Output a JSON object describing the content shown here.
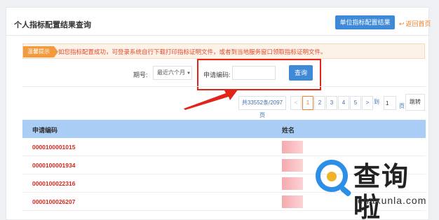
{
  "header": {
    "title": "个人指标配置结果查询",
    "unit_button": "单位指标配置结果",
    "back_label": "返回首页",
    "back_icon": "undo-icon"
  },
  "notice": {
    "tag": "温馨提示",
    "text": "如您指标配置成功，可登录系统自行下载打印指标证明文件，或者到当地服务窗口领取指标证明文件。"
  },
  "filters": {
    "period_label": "期号:",
    "period_value": "最近六个月",
    "code_label": "申请编码:",
    "code_value": "",
    "query_button": "查询"
  },
  "pagination": {
    "total": "共33552条/2097页",
    "prev": "<",
    "pages": [
      "1",
      "2",
      "3",
      "4",
      "5"
    ],
    "active_page": "1",
    "next": ">",
    "goto_label": "到",
    "goto_value": "1",
    "page_suffix": "页",
    "jump_button": "跳转"
  },
  "table": {
    "columns": [
      "申请编码",
      "姓名"
    ],
    "rows": [
      {
        "code": "0000100001015",
        "name": ""
      },
      {
        "code": "0000100001934",
        "name": ""
      },
      {
        "code": "0000100022316",
        "name": ""
      },
      {
        "code": "0000100026207",
        "name": ""
      }
    ]
  },
  "watermark": {
    "title": "查询啦",
    "url": "chaxunla.com"
  },
  "colors": {
    "primary": "#3f8ad8",
    "accent": "#f0812c",
    "highlight": "#e1251b",
    "table_header": "#a9cdf5",
    "code_text": "#d9261c"
  }
}
